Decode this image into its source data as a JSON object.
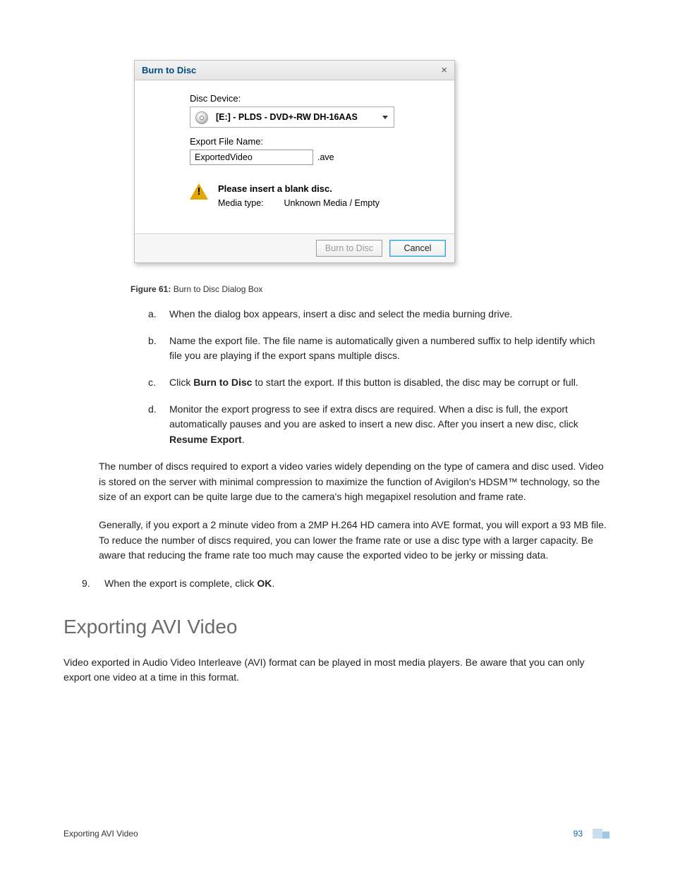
{
  "dialog": {
    "title": "Burn to Disc",
    "close_glyph": "×",
    "disc_device_label": "Disc Device:",
    "disc_device_value": "[E:] - PLDS - DVD+-RW DH-16AAS",
    "export_file_label": "Export File Name:",
    "export_file_value": "ExportedVideo",
    "export_file_ext": ".ave",
    "warning_line": "Please insert a blank disc.",
    "media_type_label": "Media type:",
    "media_type_value": "Unknown Media / Empty",
    "burn_button": "Burn to Disc",
    "cancel_button": "Cancel"
  },
  "figure_caption_label": "Figure 61:",
  "figure_caption_text": " Burn to Disc Dialog Box",
  "steps": {
    "a": "When the dialog box appears, insert a disc and select the media burning drive.",
    "b": "Name the export file. The file name is automatically given a numbered suffix to help identify which file you are playing if the export spans multiple discs.",
    "c_pre": "Click ",
    "c_bold": "Burn to Disc",
    "c_post": " to start the export. If this button is disabled, the disc may be corrupt or full.",
    "d_pre": "Monitor the export progress to see if extra discs are required. When a disc is full, the export automatically pauses and you are asked to insert a new disc. After you insert a new disc, click ",
    "d_bold": "Resume Export",
    "d_post": "."
  },
  "para1": "The number of discs required to export a video varies widely depending on the type of camera and disc used. Video is stored on the server with minimal compression to maximize the function of Avigilon's HDSM™ technology, so the size of an export can be quite large due to the camera's high megapixel resolution and frame rate.",
  "para2": "Generally, if you export a 2 minute video from a 2MP H.264 HD camera into AVE format, you will export a 93 MB file. To reduce the number of discs required, you can lower the frame rate or use a disc type with a larger capacity. Be aware that reducing the frame rate too much may cause the exported video to be jerky or missing data.",
  "step9_marker": "9.",
  "step9_pre": "When the export is complete, click ",
  "step9_bold": "OK",
  "step9_post": ".",
  "section_heading": "Exporting AVI Video",
  "section_intro": "Video exported in Audio Video Interleave (AVI) format can be played in most media players. Be aware that you can only export one video at a time in this format.",
  "footer_left": "Exporting AVI Video",
  "footer_page": "93"
}
